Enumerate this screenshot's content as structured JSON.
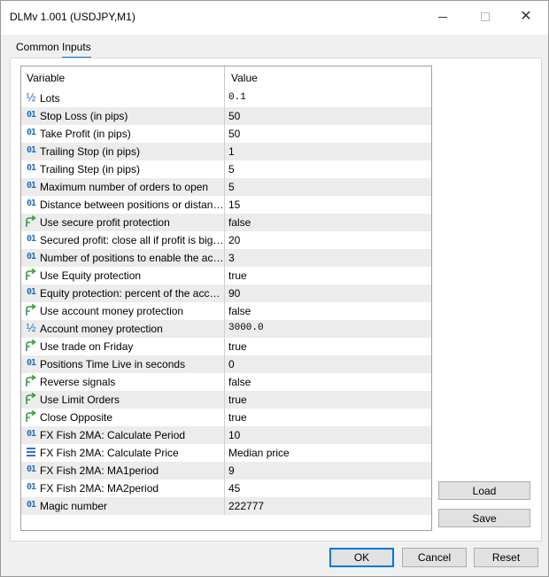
{
  "window": {
    "title": "DLMv 1.001 (USDJPY,M1)",
    "controls": {
      "minimize_icon": "minimize-icon",
      "maximize_icon": "maximize-icon",
      "close_icon": "close-icon"
    }
  },
  "tabs": [
    {
      "label": "Common",
      "active": false
    },
    {
      "label": "Inputs",
      "active": true
    }
  ],
  "grid": {
    "columns": [
      "Variable",
      "Value"
    ],
    "rows": [
      {
        "type": "double",
        "name": "Lots",
        "value": "0.1"
      },
      {
        "type": "int",
        "name": "Stop Loss (in pips)",
        "value": "50"
      },
      {
        "type": "int",
        "name": "Take Profit (in pips)",
        "value": "50"
      },
      {
        "type": "int",
        "name": "Trailing Stop (in pips)",
        "value": "1"
      },
      {
        "type": "int",
        "name": "Trailing Step (in pips)",
        "value": "5"
      },
      {
        "type": "int",
        "name": "Maximum number of orders to open",
        "value": "5"
      },
      {
        "type": "int",
        "name": "Distance between positions or distance ...",
        "value": "15"
      },
      {
        "type": "bool",
        "name": "Use secure profit protection",
        "value": "false"
      },
      {
        "type": "int",
        "name": "Secured profit: close all if profit is bigger...",
        "value": "20"
      },
      {
        "type": "int",
        "name": "Number of positions to enable the accou...",
        "value": "3"
      },
      {
        "type": "bool",
        "name": "Use Equity protection",
        "value": "true"
      },
      {
        "type": "int",
        "name": "Equity protection: percent of the account",
        "value": "90"
      },
      {
        "type": "bool",
        "name": "Use account money protection",
        "value": "false"
      },
      {
        "type": "double",
        "name": "Account money protection",
        "value": "3000.0"
      },
      {
        "type": "bool",
        "name": "Use trade on Friday",
        "value": "true"
      },
      {
        "type": "int",
        "name": "Positions Time Live in seconds",
        "value": "0"
      },
      {
        "type": "bool",
        "name": "Reverse signals",
        "value": "false"
      },
      {
        "type": "bool",
        "name": "Use Limit Orders",
        "value": "true"
      },
      {
        "type": "bool",
        "name": "Close Opposite",
        "value": "true"
      },
      {
        "type": "int",
        "name": "FX Fish 2MA: Calculate Period",
        "value": "10"
      },
      {
        "type": "enum",
        "name": "FX Fish 2MA: Calculate Price",
        "value": "Median price"
      },
      {
        "type": "int",
        "name": "FX Fish 2MA: MA1period",
        "value": "9"
      },
      {
        "type": "int",
        "name": "FX Fish 2MA: MA2period",
        "value": "45"
      },
      {
        "type": "int",
        "name": "Magic number",
        "value": "222777"
      }
    ]
  },
  "side_buttons": {
    "load": "Load",
    "save": "Save"
  },
  "footer_buttons": {
    "ok": "OK",
    "cancel": "Cancel",
    "reset": "Reset"
  },
  "colors": {
    "accent": "#0078d7",
    "int_icon": "#1f6fbf",
    "bool_icon": "#2e9e3e",
    "enum_icon": "#3a6fd0"
  }
}
